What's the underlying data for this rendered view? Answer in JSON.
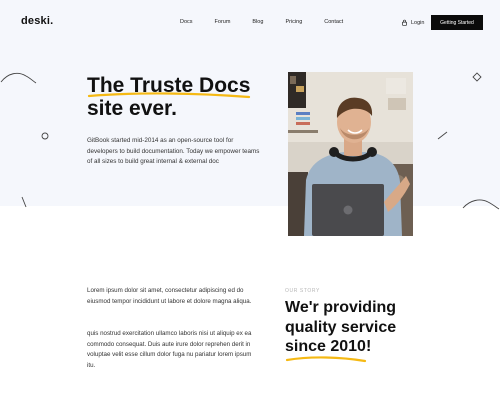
{
  "brand": {
    "logo": "deski."
  },
  "nav": {
    "items": [
      {
        "label": "Docs"
      },
      {
        "label": "Forum"
      },
      {
        "label": "Blog"
      },
      {
        "label": "Pricing"
      },
      {
        "label": "Contact"
      }
    ],
    "login_label": "Login",
    "cta_label": "Getting Started"
  },
  "hero": {
    "title_line1": "The Truste Docs",
    "title_line2": "site ever.",
    "description": "GitBook started mid-2014 as an open-source tool for developers to build documentation. Today we empower teams of all sizes to build great internal & external doc"
  },
  "story": {
    "paragraph1": "Lorem ipsum dolor sit amet, consectetur adipiscing ed do eiusmod tempor incididunt ut labore et dolore magna aliqua.",
    "paragraph2": "quis nostrud exercitation ullamco laboris nisi ut aliquip ex ea commodo consequat. Duis aute irure dolor reprehen derit in voluptae velit esse cillum dolor fuga nu pariatur lorem ipsum itu.",
    "label": "OUR STORY",
    "title_line1": "We'r providing",
    "title_line2": "quality service",
    "title_line3": "since 2010!"
  },
  "colors": {
    "accent_underline": "#f5b914",
    "hero_background": "#f5f7fc",
    "cta_background": "#0b0b0b"
  },
  "icons": {
    "login": "lock-icon"
  }
}
